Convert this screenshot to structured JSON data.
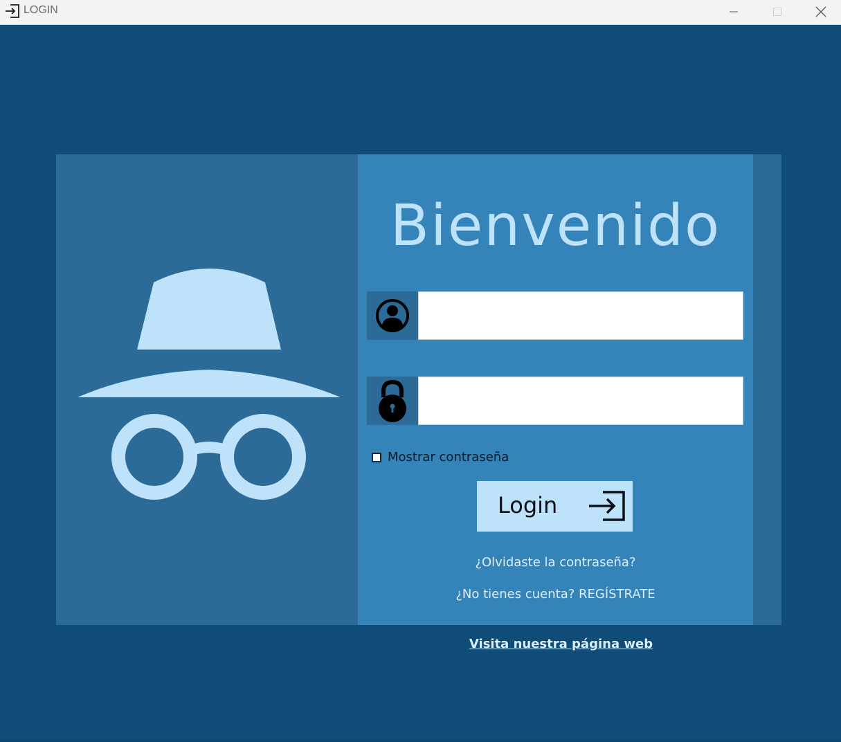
{
  "window": {
    "title": "LOGIN",
    "title_icon": "login-arrow-icon",
    "controls": [
      "minimize-icon",
      "maximize-icon",
      "close-icon"
    ]
  },
  "colors": {
    "background": "#104c78",
    "panel_dark": "#2c6b97",
    "panel_light": "#3483b9",
    "accent": "#bfe2fb"
  },
  "hero": {
    "icon": "incognito-icon"
  },
  "login_form": {
    "welcome": "Bienvenido",
    "username": {
      "icon": "user-icon",
      "value": "",
      "placeholder": ""
    },
    "password": {
      "icon": "lock-icon",
      "value": "",
      "placeholder": ""
    },
    "show_password": {
      "label": "Mostrar contraseña",
      "checked": false
    },
    "submit": {
      "label": "Login",
      "icon": "login-arrow-icon"
    },
    "forgot_link": "¿Olvidaste la contraseña?",
    "register_link": "¿No tienes cuenta? REGÍSTRATE"
  },
  "footer": {
    "website_link": "Visita nuestra página web"
  }
}
